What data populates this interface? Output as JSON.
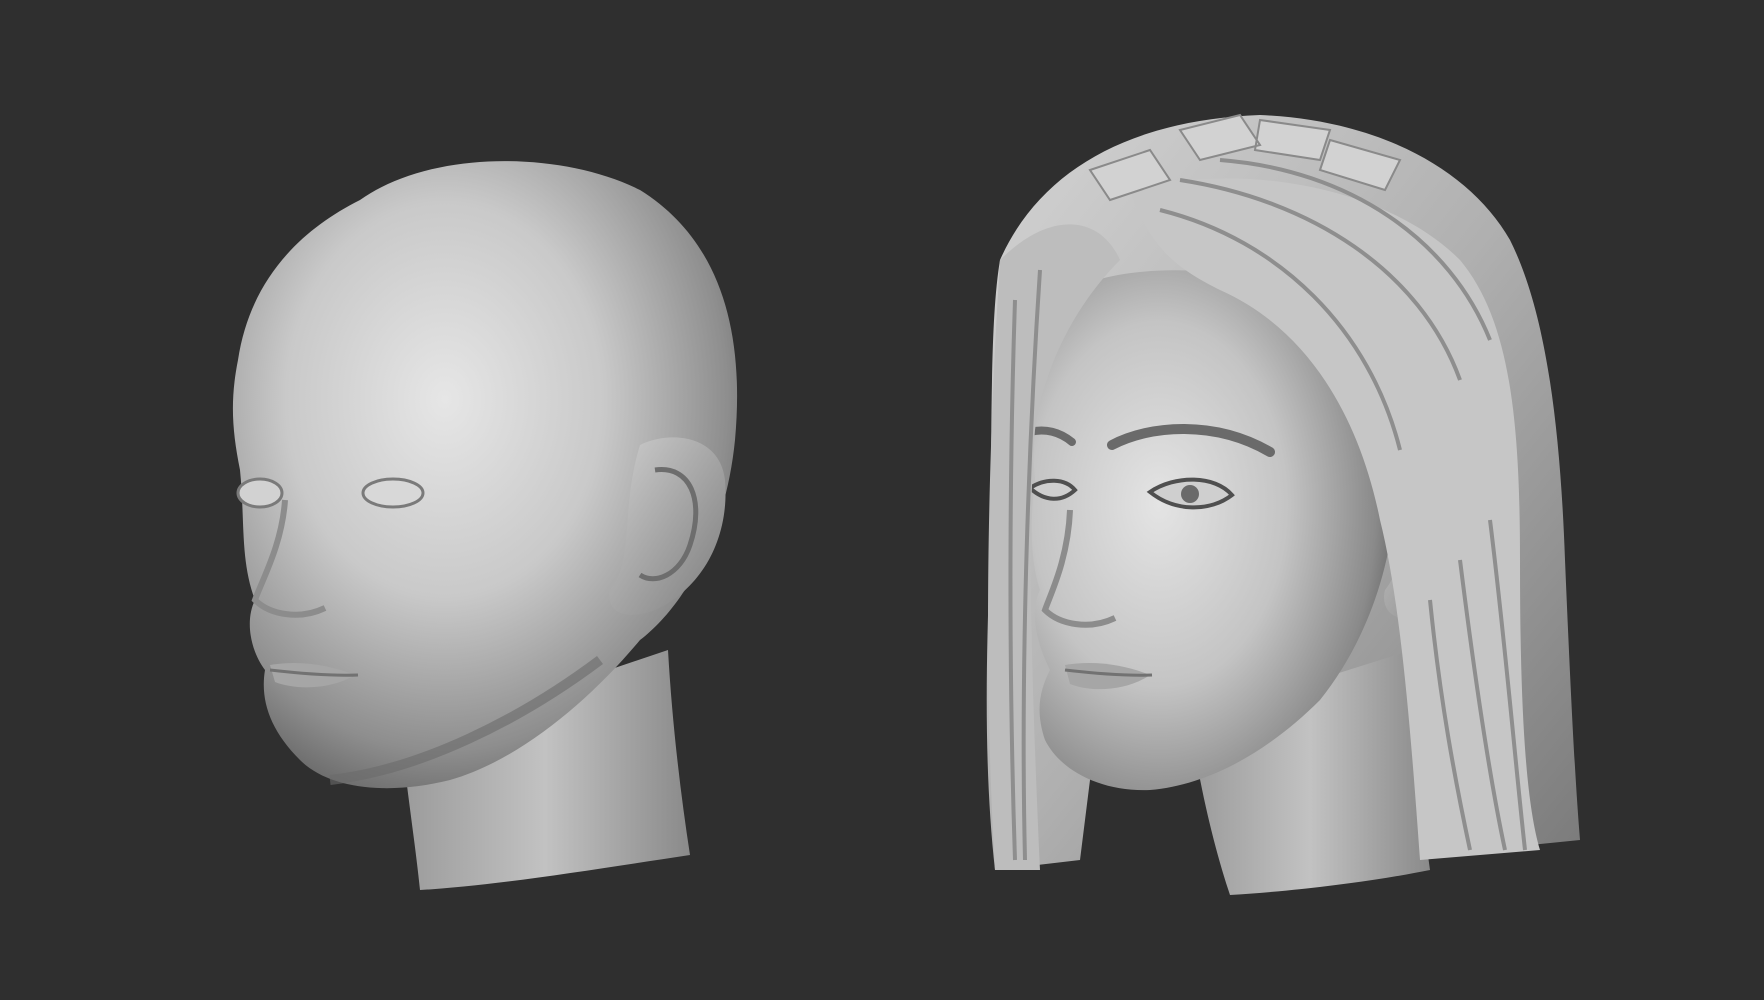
{
  "scene": {
    "background_color": "#2f2f2f",
    "material_color": "#b8b8b8",
    "models": [
      {
        "id": "bald-head",
        "description_icon": "head-sculpt-icon",
        "has_hair": false
      },
      {
        "id": "head-with-hair",
        "description_icon": "head-hair-sculpt-icon",
        "has_hair": true
      }
    ]
  }
}
